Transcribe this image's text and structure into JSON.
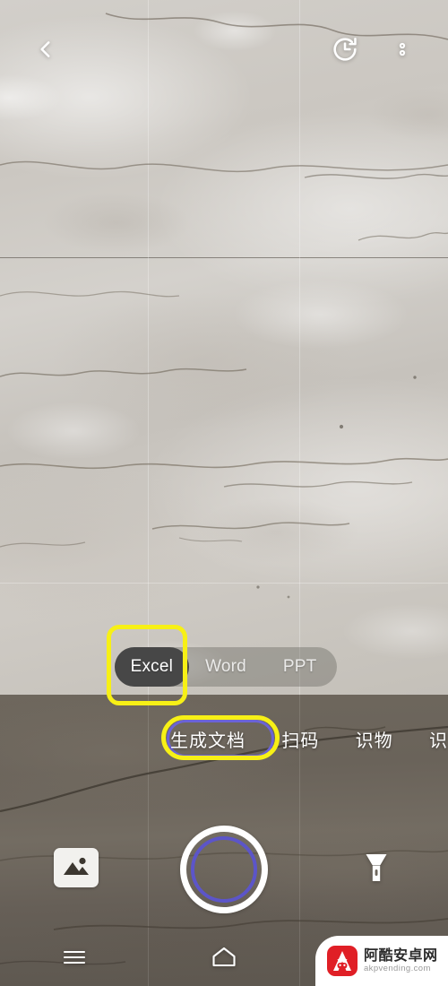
{
  "app": {
    "screen_name": "camera-document-scan",
    "accent_blue": "#5c55c9",
    "highlight_yellow": "#f7f016",
    "active_pill_dark": "#474747"
  },
  "topbar": {
    "back_label": "back-chevron",
    "history_label": "history",
    "more_label": "more-options"
  },
  "doctype": {
    "options": [
      {
        "label": "Excel",
        "active": true
      },
      {
        "label": "Word",
        "active": false
      },
      {
        "label": "PPT",
        "active": false
      }
    ]
  },
  "modes": {
    "items": [
      {
        "label": "生成文档",
        "active": true
      },
      {
        "label": "扫码",
        "active": false
      },
      {
        "label": "识物",
        "active": false
      },
      {
        "label": "识",
        "active": false
      }
    ]
  },
  "controls": {
    "gallery_label": "gallery",
    "shutter_label": "shutter",
    "torch_label": "flashlight"
  },
  "navbar": {
    "menu_label": "menu",
    "home_label": "home"
  },
  "watermark": {
    "site_cn": "阿酷安卓网",
    "site_en": "akpvending.com"
  }
}
